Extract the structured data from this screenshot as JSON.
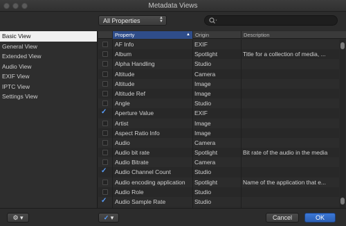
{
  "window": {
    "title": "Metadata Views"
  },
  "toolbar": {
    "popup_label": "All Properties",
    "search_placeholder": ""
  },
  "sidebar": {
    "items": [
      {
        "label": "Basic View",
        "selected": true
      },
      {
        "label": "General View",
        "selected": false
      },
      {
        "label": "Extended View",
        "selected": false
      },
      {
        "label": "Audio View",
        "selected": false
      },
      {
        "label": "EXIF View",
        "selected": false
      },
      {
        "label": "IPTC View",
        "selected": false
      },
      {
        "label": "Settings View",
        "selected": false
      }
    ]
  },
  "table": {
    "headers": {
      "property": "Property",
      "origin": "Origin",
      "description": "Description"
    },
    "rows": [
      {
        "checked": false,
        "property": "AF Info",
        "origin": "EXIF",
        "description": ""
      },
      {
        "checked": false,
        "property": "Album",
        "origin": "Spotlight",
        "description": "Title for a collection of media, ..."
      },
      {
        "checked": false,
        "property": "Alpha Handling",
        "origin": "Studio",
        "description": ""
      },
      {
        "checked": false,
        "property": "Altitude",
        "origin": "Camera",
        "description": ""
      },
      {
        "checked": false,
        "property": "Altitude",
        "origin": "Image",
        "description": ""
      },
      {
        "checked": false,
        "property": "Altitude Ref",
        "origin": "Image",
        "description": ""
      },
      {
        "checked": false,
        "property": "Angle",
        "origin": "Studio",
        "description": ""
      },
      {
        "checked": true,
        "property": "Aperture Value",
        "origin": "EXIF",
        "description": ""
      },
      {
        "checked": false,
        "property": "Artist",
        "origin": "Image",
        "description": ""
      },
      {
        "checked": false,
        "property": "Aspect Ratio Info",
        "origin": "Image",
        "description": ""
      },
      {
        "checked": false,
        "property": "Audio",
        "origin": "Camera",
        "description": ""
      },
      {
        "checked": false,
        "property": "Audio bit rate",
        "origin": "Spotlight",
        "description": "Bit rate of the audio in the media"
      },
      {
        "checked": false,
        "property": "Audio Bitrate",
        "origin": "Camera",
        "description": ""
      },
      {
        "checked": true,
        "property": "Audio Channel Count",
        "origin": "Studio",
        "description": ""
      },
      {
        "checked": false,
        "property": "Audio encoding application",
        "origin": "Spotlight",
        "description": "Name of the application that e..."
      },
      {
        "checked": false,
        "property": "Audio Role",
        "origin": "Studio",
        "description": ""
      },
      {
        "checked": true,
        "property": "Audio Sample Rate",
        "origin": "Studio",
        "description": ""
      }
    ]
  },
  "footer": {
    "gear_label": "▾",
    "check_label": "▾",
    "cancel_label": "Cancel",
    "ok_label": "OK"
  }
}
